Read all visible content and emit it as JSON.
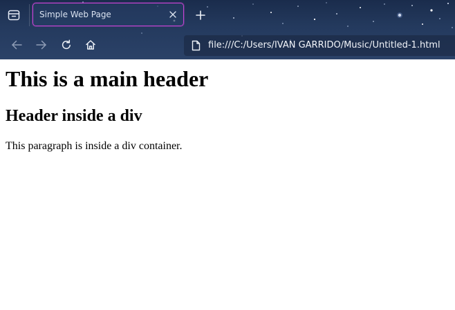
{
  "browser": {
    "tabs": [
      {
        "title": "Simple Web Page",
        "active": true
      }
    ],
    "address_bar": {
      "url": "file:///C:/Users/IVAN GARRIDO/Music/Untitled-1.html"
    },
    "icons": {
      "tab_manager": "tab-manager-icon",
      "tab_close": "close-icon",
      "new_tab": "plus-icon",
      "back": "arrow-left-icon",
      "forward": "arrow-right-icon",
      "reload": "reload-icon",
      "home": "home-icon",
      "page": "page-icon"
    },
    "colors": {
      "active_tab_border": "#c644d4",
      "chrome_background": "#243a5e"
    }
  },
  "page": {
    "main_header": "This is a main header",
    "div_header": "Header inside a div",
    "div_paragraph": "This paragraph is inside a div container."
  }
}
